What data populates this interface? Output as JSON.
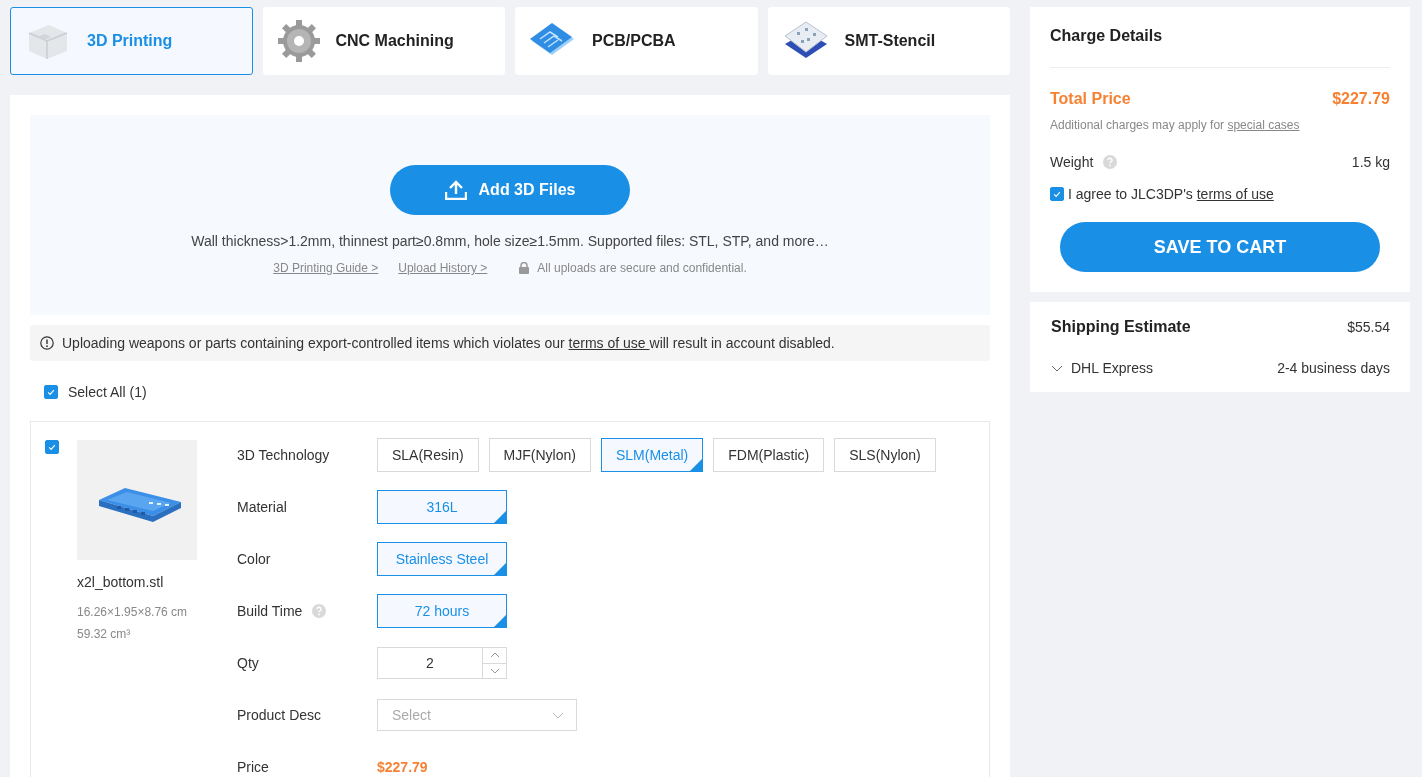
{
  "service_tabs": [
    {
      "label": "3D Printing",
      "selected": true,
      "kind": "printing"
    },
    {
      "label": "CNC Machining",
      "selected": false,
      "kind": "cnc"
    },
    {
      "label": "PCB/PCBA",
      "selected": false,
      "kind": "pcb"
    },
    {
      "label": "SMT-Stencil",
      "selected": false,
      "kind": "stencil"
    }
  ],
  "upload": {
    "button": "Add 3D Files",
    "requirements": "Wall thickness>1.2mm, thinnest part≥0.8mm, hole size≥1.5mm. Supported files: STL, STP, and more…",
    "links": [
      "3D Printing Guide >",
      "Upload History >"
    ],
    "security_note": "All uploads are secure and confidential."
  },
  "warning": {
    "before": "Uploading weapons or parts containing export-controlled items which violates our ",
    "link": "terms of use ",
    "after": "will result in account disabled."
  },
  "select_all": {
    "label": "Select All (1)",
    "checked": true
  },
  "part": {
    "checked": true,
    "file_name": "x2l_bottom.stl",
    "dimensions": "16.26×1.95×8.76 cm",
    "volume": "59.32 cm³",
    "options": [
      {
        "kind": "choices",
        "label": "3D Technology",
        "help": false,
        "choices": [
          {
            "label": "SLA(Resin)",
            "selected": false
          },
          {
            "label": "MJF(Nylon)",
            "selected": false
          },
          {
            "label": "SLM(Metal)",
            "selected": true
          },
          {
            "label": "FDM(Plastic)",
            "selected": false
          },
          {
            "label": "SLS(Nylon)",
            "selected": false
          }
        ]
      },
      {
        "kind": "choices",
        "label": "Material",
        "help": false,
        "choices": [
          {
            "label": "316L",
            "selected": true
          }
        ]
      },
      {
        "kind": "choices",
        "label": "Color",
        "help": false,
        "choices": [
          {
            "label": "Stainless Steel",
            "selected": true
          }
        ]
      },
      {
        "kind": "choices",
        "label": "Build Time",
        "help": true,
        "choices": [
          {
            "label": "72 hours",
            "selected": true
          }
        ]
      },
      {
        "kind": "stepper",
        "label": "Qty",
        "help": false,
        "value": "2"
      },
      {
        "kind": "select",
        "label": "Product Desc",
        "help": false,
        "placeholder": "Select"
      },
      {
        "kind": "price",
        "label": "Price",
        "help": false,
        "value": "$227.79"
      }
    ]
  },
  "charge_details": {
    "title": "Charge Details",
    "total_label": "Total Price",
    "total_value": "$227.79",
    "note": "Additional charges may apply for ",
    "note_link": "special cases",
    "weight_label": "Weight",
    "weight_help": true,
    "weight_value": "1.5 kg",
    "agree": {
      "checked": true,
      "text": "I agree to JLC3DP's ",
      "link": "terms of use"
    },
    "button": "SAVE TO CART"
  },
  "shipping": {
    "title": "Shipping Estimate",
    "price": "$55.54",
    "carrier": "DHL Express",
    "expanded": false,
    "delivery": "2-4 business days"
  }
}
